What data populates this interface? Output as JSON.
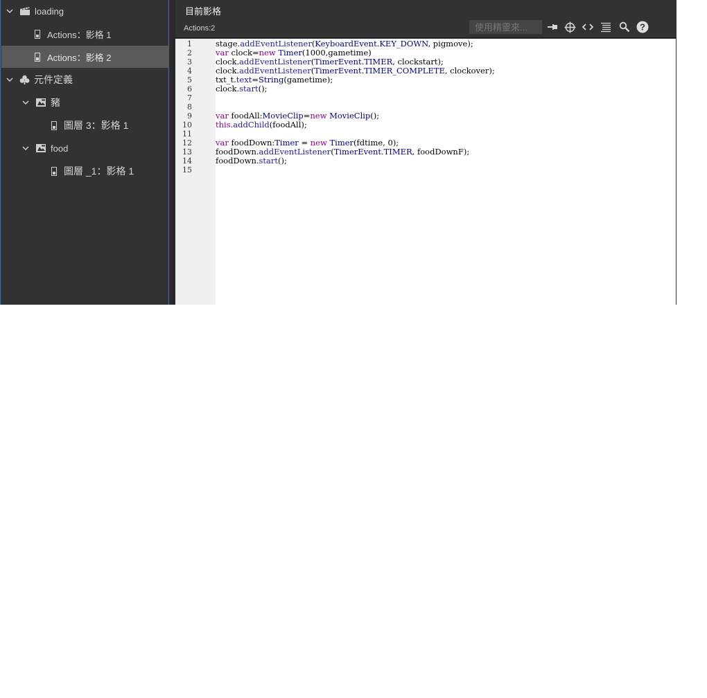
{
  "tree": {
    "items": [
      {
        "label": "loading",
        "icon": "scene-icon"
      },
      {
        "label": "Actions：影格 1",
        "icon": "frame-icon"
      },
      {
        "label": "Actions：影格 2",
        "icon": "frame-icon",
        "selected": true
      },
      {
        "label": "元件定義",
        "icon": "symbol-definitions-icon"
      },
      {
        "label": "豬",
        "icon": "movieclip-icon"
      },
      {
        "label": "圖層 3：影格 1",
        "icon": "frame-icon"
      },
      {
        "label": "food",
        "icon": "movieclip-icon"
      },
      {
        "label": "圖層 _1：影格 1",
        "icon": "frame-icon"
      }
    ]
  },
  "header": {
    "title": "目前影格",
    "subtitle": "Actions:2",
    "search_placeholder": "使用精靈來..."
  },
  "toolbar": {
    "icons": [
      "pin-icon",
      "target-icon",
      "code-snippet-icon",
      "format-icon",
      "search-icon",
      "help-icon"
    ]
  },
  "editor": {
    "line_numbers": [
      "1",
      "2",
      "3",
      "4",
      "5",
      "6",
      "7",
      "8",
      "9",
      "10",
      "11",
      "12",
      "13",
      "14",
      "15"
    ],
    "lines": [
      "stage.addEventListener(KeyboardEvent.KEY_DOWN, pigmove);",
      "var clock=new Timer(1000,gametime)",
      "clock.addEventListener(TimerEvent.TIMER, clockstart);",
      "clock.addEventListener(TimerEvent.TIMER_COMPLETE, clockover);",
      "txt_t.text=String(gametime);",
      "clock.start();",
      "",
      "",
      "var foodAll:MovieClip=new MovieClip();",
      "this.addChild(foodAll);",
      "",
      "var foodDown:Timer = new Timer(fdtime, 0);",
      "foodDown.addEventListener(TimerEvent.TIMER, foodDownF);",
      "foodDown.start();",
      ""
    ]
  },
  "colors": {
    "panel": "#323232",
    "selected_row": "#5a5a5a",
    "keyword": "#8b008b",
    "type": "#00008b"
  }
}
